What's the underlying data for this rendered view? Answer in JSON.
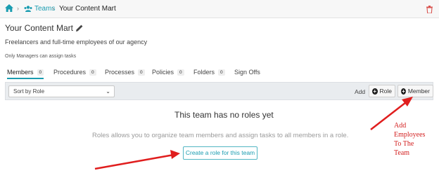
{
  "breadcrumb": {
    "home_icon": "home-icon",
    "teams": "Teams",
    "current": "Your Content Mart"
  },
  "page": {
    "title": "Your Content Mart",
    "description": "Freelancers and full-time employees of our agency",
    "note": "Only Managers can assign tasks"
  },
  "tabs": [
    {
      "label": "Members",
      "count": "0"
    },
    {
      "label": "Procedures",
      "count": "0"
    },
    {
      "label": "Processes",
      "count": "0"
    },
    {
      "label": "Policies",
      "count": "0"
    },
    {
      "label": "Folders",
      "count": "0"
    },
    {
      "label": "Sign Offs",
      "count": ""
    }
  ],
  "toolbar": {
    "sort_value": "Sort by Role",
    "add_label": "Add",
    "role_button": "Role",
    "member_button": "Member"
  },
  "empty_state": {
    "title": "This team has no roles yet",
    "description": "Roles allows you to organize team members and assign tasks to all members in a role.",
    "create_button": "Create a role for this team"
  },
  "annotation": {
    "lines": [
      "Add",
      "Employees",
      "To The",
      "Team"
    ]
  },
  "colors": {
    "accent": "#1a9cb0",
    "annotation": "#d32020"
  }
}
